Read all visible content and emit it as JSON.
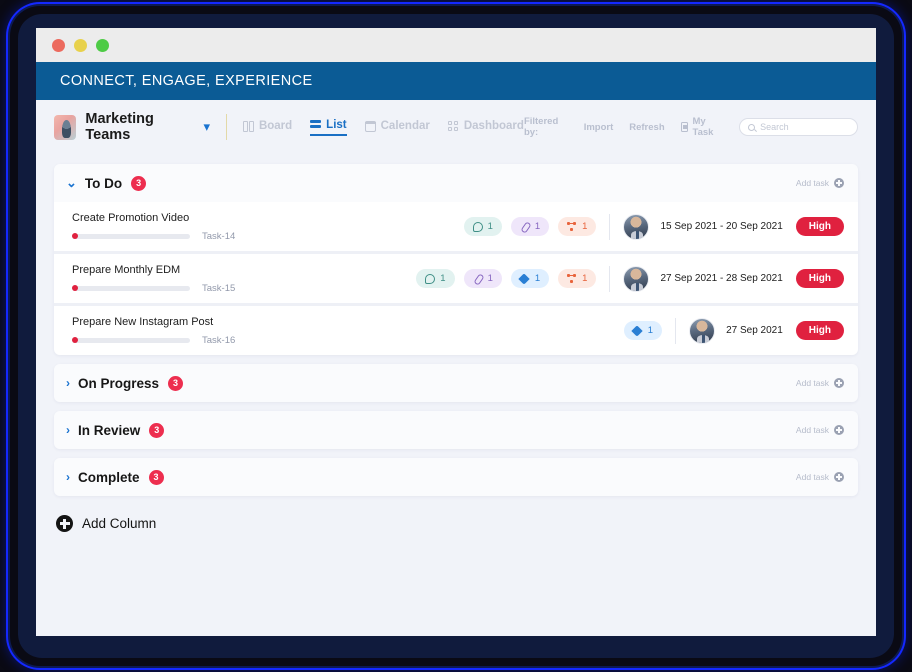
{
  "window": {
    "traffic_lights": [
      "close",
      "minimize",
      "maximize"
    ],
    "banner_text": "CONNECT, ENGAGE, EXPERIENCE",
    "banner_color": "#0b5b95"
  },
  "toolbar": {
    "team_name": "Marketing Teams",
    "caret": "⌄",
    "tabs": [
      {
        "label": "Board",
        "icon": "board-icon",
        "active": false
      },
      {
        "label": "List",
        "icon": "list-icon",
        "active": true
      },
      {
        "label": "Calendar",
        "icon": "calendar-icon",
        "active": false
      },
      {
        "label": "Dashboard",
        "icon": "dashboard-icon",
        "active": false
      }
    ],
    "filtered_by_label": "Filtered by:",
    "import_label": "Import",
    "refresh_label": "Refresh",
    "my_task_label": "My Task",
    "search_placeholder": "Search",
    "search_value": ""
  },
  "board": {
    "add_task_label": "Add task",
    "add_column_label": "Add Column",
    "accent_blue": "#1a73d0",
    "badge_red": "#ed2e4f",
    "priority_red": "#e0213f",
    "groups": [
      {
        "title": "To Do",
        "count": "3",
        "expanded": true,
        "add_task_label": "Add task",
        "tasks": [
          {
            "title": "Create Promotion Video",
            "code": "Task-14",
            "progress": 0,
            "chips": [
              {
                "type": "comment",
                "icon": "comment-icon",
                "value": "1"
              },
              {
                "type": "attach",
                "icon": "attach-icon",
                "value": "1"
              },
              {
                "type": "share",
                "icon": "share-icon",
                "value": "1"
              }
            ],
            "assignee": "avatar",
            "date": "15 Sep 2021 - 20 Sep 2021",
            "priority": "High"
          },
          {
            "title": "Prepare Monthly EDM",
            "code": "Task-15",
            "progress": 0,
            "chips": [
              {
                "type": "comment",
                "icon": "comment-icon",
                "value": "1"
              },
              {
                "type": "attach",
                "icon": "attach-icon",
                "value": "1"
              },
              {
                "type": "tag",
                "icon": "tag-icon",
                "value": "1"
              },
              {
                "type": "share",
                "icon": "share-icon",
                "value": "1"
              }
            ],
            "assignee": "avatar",
            "date": "27 Sep 2021 - 28 Sep 2021",
            "priority": "High"
          },
          {
            "title": "Prepare New Instagram Post",
            "code": "Task-16",
            "progress": 0,
            "chips": [
              {
                "type": "tag",
                "icon": "tag-icon",
                "value": "1"
              }
            ],
            "assignee": "avatar",
            "date": "27 Sep 2021",
            "priority": "High"
          }
        ]
      },
      {
        "title": "On Progress",
        "count": "3",
        "expanded": false,
        "add_task_label": "Add task",
        "tasks": []
      },
      {
        "title": "In Review",
        "count": "3",
        "expanded": false,
        "add_task_label": "Add task",
        "tasks": []
      },
      {
        "title": "Complete",
        "count": "3",
        "expanded": false,
        "add_task_label": "Add task",
        "tasks": []
      }
    ]
  }
}
